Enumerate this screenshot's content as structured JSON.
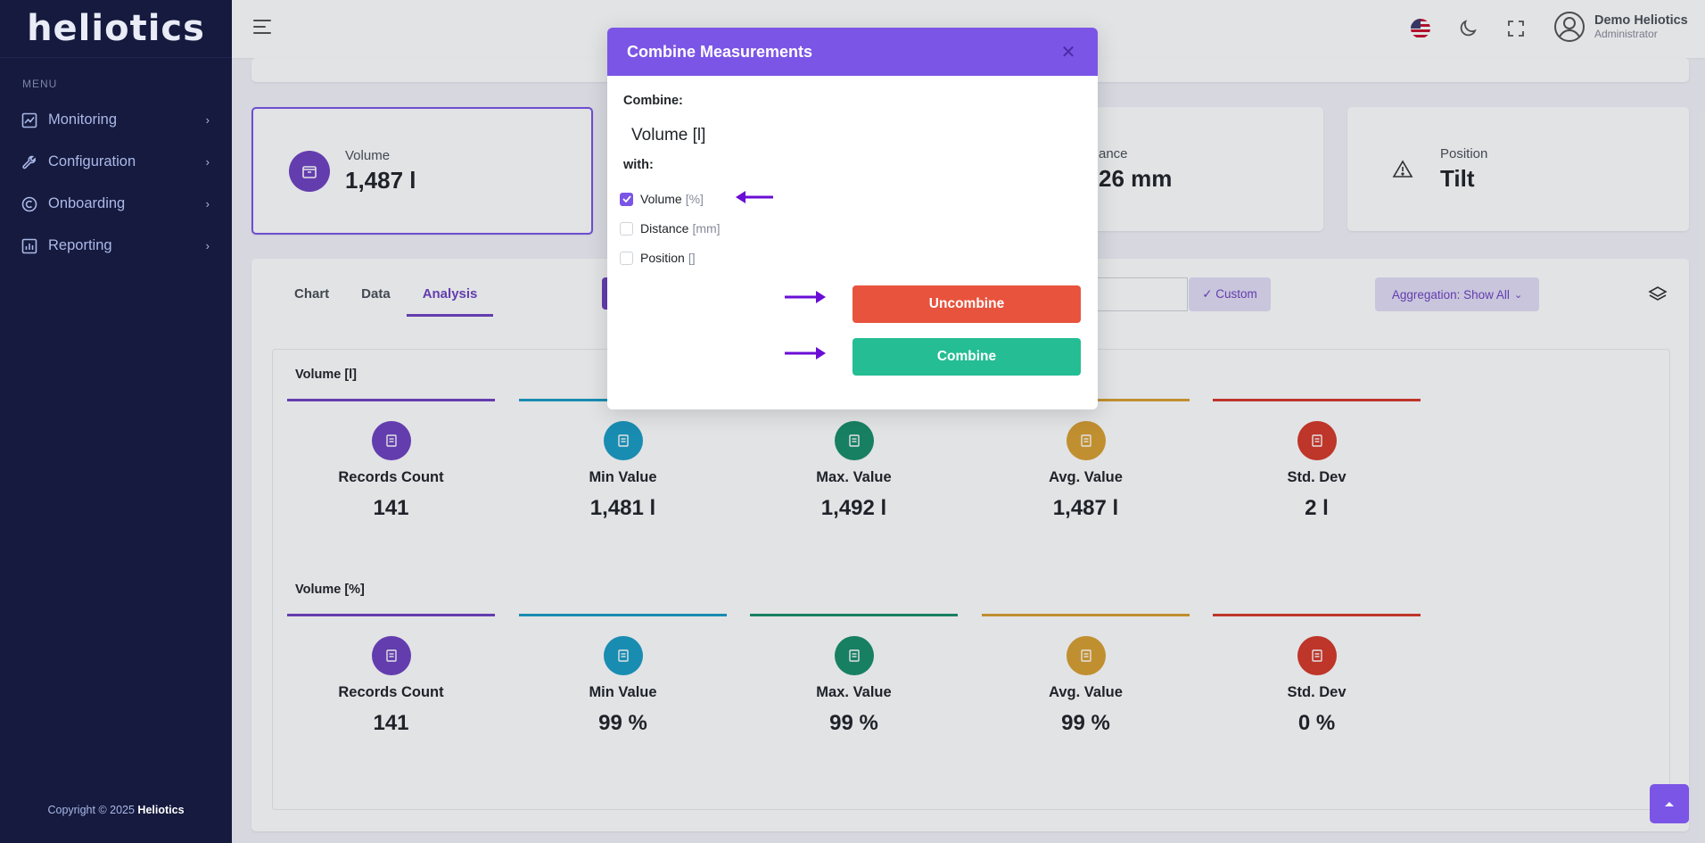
{
  "app": {
    "logo_text": "heliotics"
  },
  "sidebar": {
    "menu_title": "MENU",
    "items": [
      {
        "label": "Monitoring",
        "icon": "chart-line-icon"
      },
      {
        "label": "Configuration",
        "icon": "wrench-icon"
      },
      {
        "label": "Onboarding",
        "icon": "onboarding-icon"
      },
      {
        "label": "Reporting",
        "icon": "bar-chart-icon"
      }
    ],
    "copyright_prefix": "Copyright © 2025",
    "copyright_brand": "Heliotics"
  },
  "topbar": {
    "user_name": "Demo Heliotics",
    "user_role": "Administrator"
  },
  "stats": [
    {
      "label": "Volume",
      "value": "1,487 l",
      "icon": "package-icon"
    },
    {
      "label": "ance",
      "value": "26 mm"
    },
    {
      "label": "Position",
      "value": "Tilt",
      "icon": "warning-triangle-icon"
    }
  ],
  "tabs": [
    "Chart",
    "Data",
    "Analysis"
  ],
  "active_tab": "Analysis",
  "toolbar": {
    "custom_label": "✓ Custom",
    "aggregation_label": "Aggregation: Show All"
  },
  "groups": [
    {
      "title": "Volume [l]",
      "metrics": [
        {
          "label": "Records Count",
          "value": "141",
          "color": "#6f42c1"
        },
        {
          "label": "Min Value",
          "value": "1,481 l",
          "color": "#1b9dc4"
        },
        {
          "label": "Max. Value",
          "value": "1,492 l",
          "color": "#1a8f6a"
        },
        {
          "label": "Avg. Value",
          "value": "1,487 l",
          "color": "#d9a031"
        },
        {
          "label": "Std. Dev",
          "value": "2 l",
          "color": "#d63a2a"
        }
      ]
    },
    {
      "title": "Volume [%]",
      "metrics": [
        {
          "label": "Records Count",
          "value": "141",
          "color": "#6f42c1"
        },
        {
          "label": "Min Value",
          "value": "99 %",
          "color": "#1b9dc4"
        },
        {
          "label": "Max. Value",
          "value": "99 %",
          "color": "#1a8f6a"
        },
        {
          "label": "Avg. Value",
          "value": "99 %",
          "color": "#d9a031"
        },
        {
          "label": "Std. Dev",
          "value": "0 %",
          "color": "#d63a2a"
        }
      ]
    }
  ],
  "modal": {
    "title": "Combine Measurements",
    "combine_label": "Combine:",
    "combine_value": "Volume [l]",
    "with_label": "with:",
    "options": [
      {
        "label": "Volume",
        "unit": "[%]",
        "checked": true
      },
      {
        "label": "Distance",
        "unit": "[mm]",
        "checked": false
      },
      {
        "label": "Position",
        "unit": "[]",
        "checked": false
      }
    ],
    "uncombine_label": "Uncombine",
    "combine_button_label": "Combine",
    "colors": {
      "header": "#7b55e6",
      "uncombine": "#e8533d",
      "combine": "#25bd94",
      "arrow": "#6a0dd6"
    }
  }
}
